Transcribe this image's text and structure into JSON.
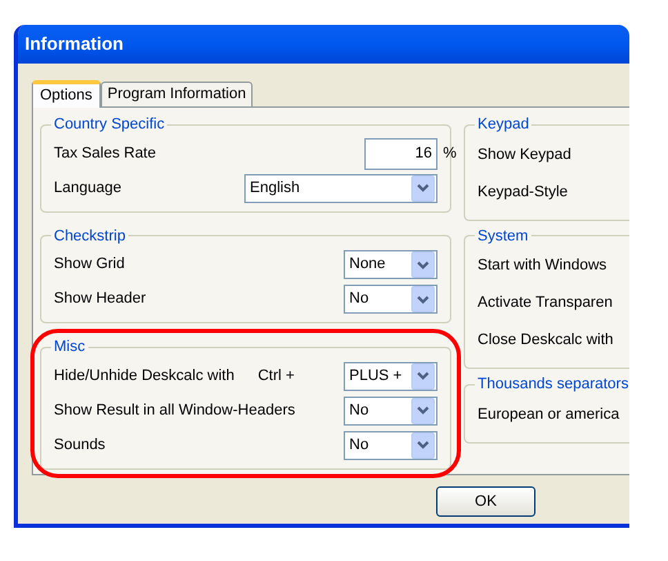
{
  "window": {
    "title": "Information"
  },
  "tabs": [
    {
      "label": "Options",
      "selected": true
    },
    {
      "label": "Program Information",
      "selected": false
    }
  ],
  "left_groups": [
    {
      "title": "Country Specific",
      "rows": [
        {
          "kind": "number",
          "label": "Tax Sales Rate",
          "value": "16",
          "unit": "%"
        },
        {
          "kind": "wide-select",
          "label": "Language",
          "value": "English"
        }
      ]
    },
    {
      "title": "Checkstrip",
      "rows": [
        {
          "kind": "select",
          "label": "Show Grid",
          "value": "None"
        },
        {
          "kind": "select",
          "label": "Show Header",
          "value": "No"
        }
      ]
    },
    {
      "title": "Misc",
      "rows": [
        {
          "kind": "select",
          "label": "Hide/Unhide Deskcalc with",
          "modifier": "Ctrl +",
          "value": "PLUS +"
        },
        {
          "kind": "select",
          "label": "Show Result in all Window-Headers",
          "value": "No"
        },
        {
          "kind": "select",
          "label": "Sounds",
          "value": "No"
        }
      ]
    }
  ],
  "right_groups": [
    {
      "title": "Keypad",
      "rows": [
        "Show Keypad",
        "Keypad-Style"
      ]
    },
    {
      "title": "System",
      "rows": [
        "Start with Windows",
        "Activate Transparen",
        "Close Deskcalc with"
      ]
    },
    {
      "title": "Thousands separators",
      "rows": [
        "European or america"
      ]
    }
  ],
  "buttons": [
    {
      "label": "OK"
    }
  ]
}
